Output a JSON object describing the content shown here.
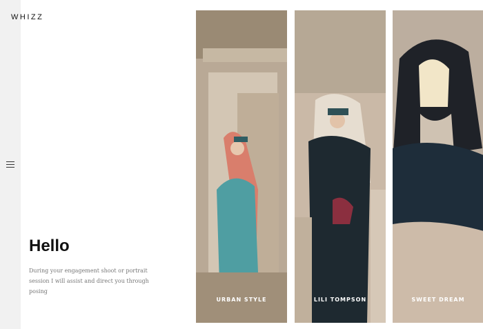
{
  "brand": {
    "logo": "WHIZZ"
  },
  "hero": {
    "title": "Hello",
    "text": "During your engagement shoot or portrait session I will assist and direct you through posing"
  },
  "gallery": {
    "cards": [
      {
        "label": "URBAN STYLE"
      },
      {
        "label": "LILI TOMPSON"
      },
      {
        "label": "SWEET DREAM"
      }
    ]
  }
}
